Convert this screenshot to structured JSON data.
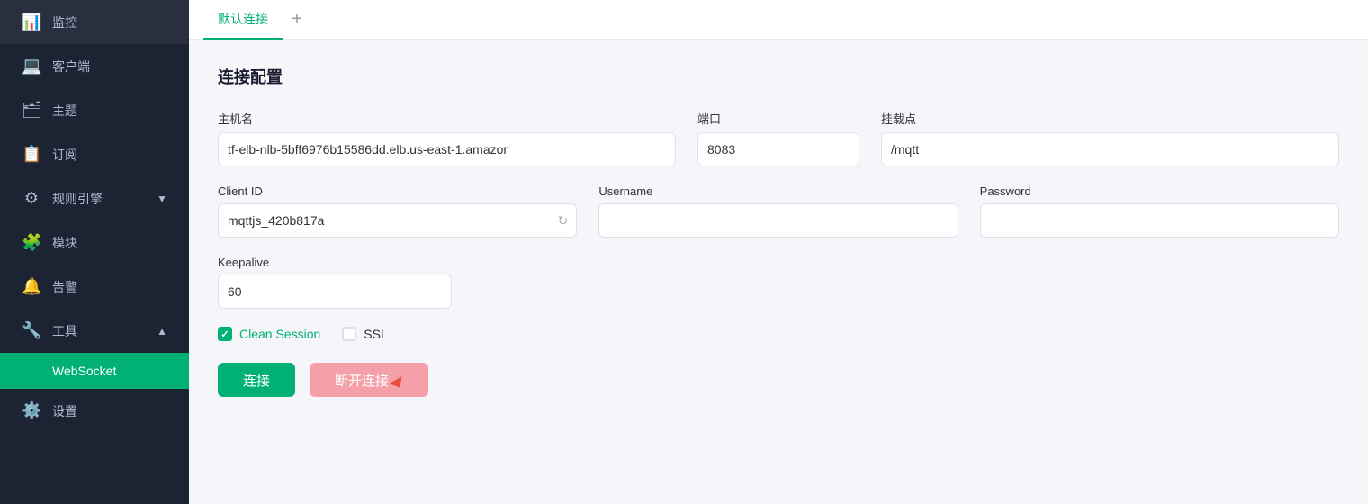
{
  "sidebar": {
    "items": [
      {
        "id": "monitor",
        "label": "监控",
        "icon": "📊",
        "active": false,
        "hasArrow": false
      },
      {
        "id": "client",
        "label": "客户端",
        "icon": "💻",
        "active": false,
        "hasArrow": false
      },
      {
        "id": "topics",
        "label": "主题",
        "icon": "🗂",
        "active": false,
        "hasArrow": false
      },
      {
        "id": "subscribe",
        "label": "订阅",
        "icon": "📋",
        "active": false,
        "hasArrow": false
      },
      {
        "id": "rules",
        "label": "规则引擎",
        "icon": "⚙",
        "active": false,
        "hasArrow": true,
        "expanded": false
      },
      {
        "id": "modules",
        "label": "模块",
        "icon": "🧩",
        "active": false,
        "hasArrow": false
      },
      {
        "id": "alerts",
        "label": "告警",
        "icon": "🔔",
        "active": false,
        "hasArrow": false
      },
      {
        "id": "tools",
        "label": "工具",
        "icon": "🔧",
        "active": false,
        "hasArrow": true,
        "expanded": true
      },
      {
        "id": "settings",
        "label": "设置",
        "icon": "⚙️",
        "active": false,
        "hasArrow": false
      }
    ],
    "sub_items": [
      {
        "id": "websocket",
        "label": "WebSocket",
        "active": true
      }
    ]
  },
  "tabs": [
    {
      "id": "default",
      "label": "默认连接",
      "active": true
    }
  ],
  "tab_add_label": "+",
  "content": {
    "section_title": "连接配置",
    "fields": {
      "hostname": {
        "label": "主机名",
        "value": "tf-elb-nlb-5bff6976b15586dd.elb.us-east-1.amazor",
        "placeholder": ""
      },
      "port": {
        "label": "端口",
        "value": "8083",
        "placeholder": ""
      },
      "mount": {
        "label": "挂载点",
        "value": "/mqtt",
        "placeholder": ""
      },
      "client_id": {
        "label": "Client ID",
        "value": "mqttjs_420b817a",
        "placeholder": ""
      },
      "username": {
        "label": "Username",
        "value": "",
        "placeholder": ""
      },
      "password": {
        "label": "Password",
        "value": "",
        "placeholder": ""
      },
      "keepalive": {
        "label": "Keepalive",
        "value": "60",
        "placeholder": ""
      }
    },
    "checkboxes": {
      "clean_session": {
        "label": "Clean Session",
        "checked": true
      },
      "ssl": {
        "label": "SSL",
        "checked": false
      }
    },
    "buttons": {
      "connect": "连接",
      "disconnect": "断开连接"
    }
  }
}
